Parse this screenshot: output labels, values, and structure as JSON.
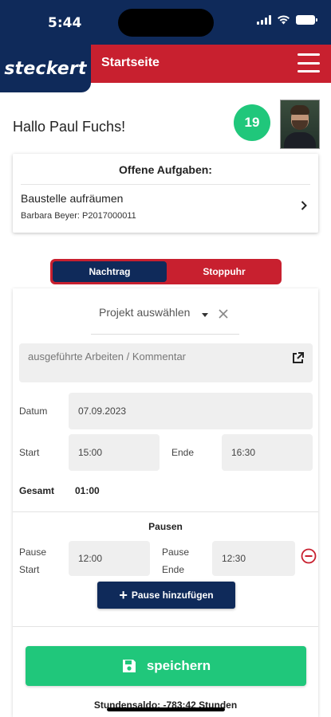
{
  "status_bar": {
    "time": "5:44"
  },
  "header": {
    "logo": "steckert",
    "title": "Startseite"
  },
  "greeting": "Hallo Paul Fuchs!",
  "badge_count": "19",
  "tasks": {
    "title": "Offene Aufgaben:",
    "items": [
      {
        "title": "Baustelle aufräumen",
        "subtitle": "Barbara Beyer: P2017000011"
      }
    ]
  },
  "segment": {
    "options": [
      "Nachtrag",
      "Stoppuhr"
    ],
    "selected": "Nachtrag"
  },
  "form": {
    "project_placeholder": "Projekt auswählen",
    "comment_placeholder": "ausgeführte Arbeiten / Kommentar",
    "date_label": "Datum",
    "date_value": "07.09.2023",
    "start_label": "Start",
    "start_value": "15:00",
    "end_label": "Ende",
    "end_value": "16:30",
    "total_label": "Gesamt",
    "total_value": "01:00",
    "pauses_title": "Pausen",
    "pause_start_label": "Pause\nStart",
    "pause_start_value": "12:00",
    "pause_end_label": "Pause\nEnde",
    "pause_end_value": "12:30",
    "add_pause_label": "Pause hinzufügen",
    "save_label": "speichern",
    "balance_text": "Stundensaldo: -783:42 Stunden"
  },
  "colors": {
    "navy": "#0f2a5a",
    "red": "#c8202f",
    "green": "#20c77b"
  }
}
